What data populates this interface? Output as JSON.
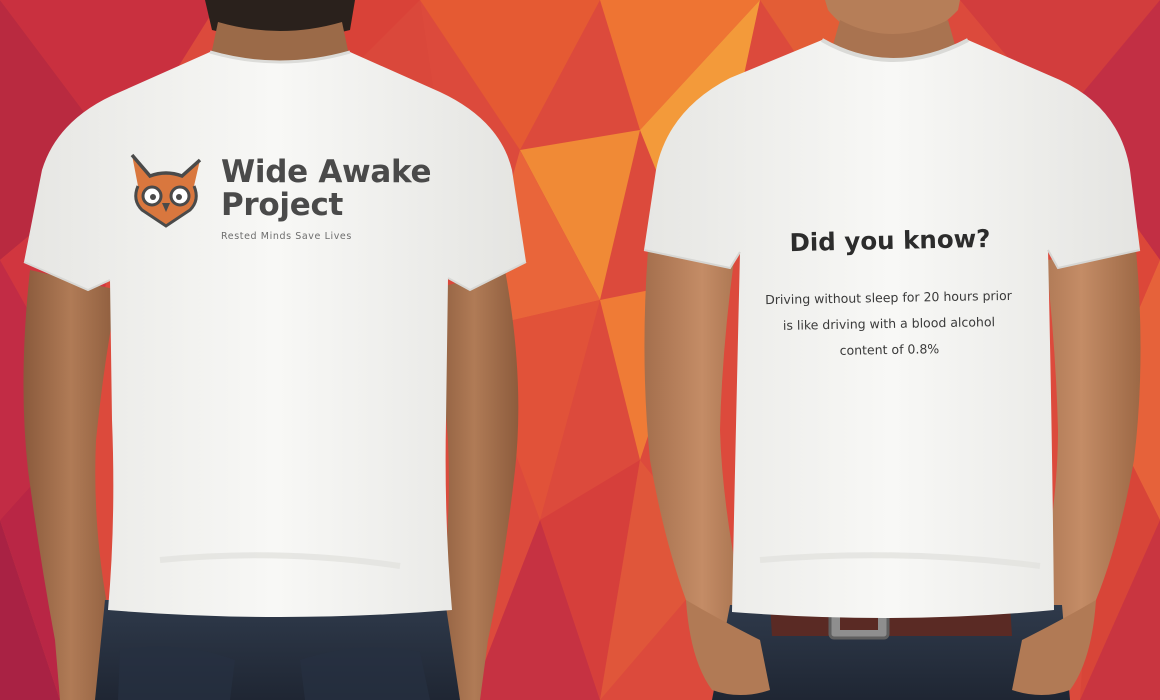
{
  "back_shirt": {
    "logo_icon": "owl-head-icon",
    "brand_name": "Wide Awake\nProject",
    "tagline": "Rested Minds Save Lives"
  },
  "front_shirt": {
    "heading": "Did you know?",
    "body": "Driving without sleep for 20 hours prior is like driving with a blood alcohol content of 0.8%"
  },
  "colors": {
    "background_warm": "#e9573a",
    "background_deep": "#c8283f",
    "shirt": "#f4f4f2",
    "logo_orange": "#d9773e",
    "logo_dark": "#4a4a4a",
    "jeans": "#2b3442",
    "belt": "#5a2a24"
  }
}
